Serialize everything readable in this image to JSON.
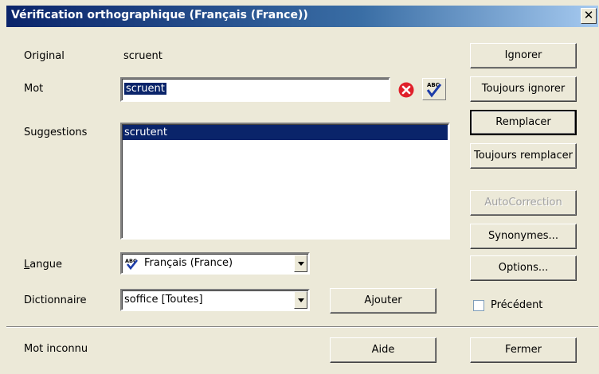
{
  "window": {
    "title": "Vérification orthographique (Français (France))",
    "close_label": "✕"
  },
  "original": {
    "label": "Original",
    "value": "scruent"
  },
  "mot": {
    "label": "Mot",
    "value": "scruent"
  },
  "suggestions": {
    "label": "Suggestions",
    "items": [
      "scrutent"
    ]
  },
  "langue": {
    "label": "Langue",
    "value": "Français (France)"
  },
  "dictionnaire": {
    "label": "Dictionnaire",
    "value": "soffice [Toutes]"
  },
  "buttons": {
    "ignorer": "Ignorer",
    "toujours_ignorer": "Toujours ignorer",
    "remplacer": "Remplacer",
    "toujours_remplacer": "Toujours remplacer",
    "autocorrection": "AutoCorrection",
    "synonymes": "Synonymes...",
    "options": "Options...",
    "ajouter": "Ajouter",
    "aide": "Aide",
    "fermer": "Fermer"
  },
  "precedent": {
    "label": "Précédent",
    "checked": false
  },
  "status": "Mot inconnu",
  "colors": {
    "selection": "#0a246a",
    "title_gradient_start": "#0a246a",
    "delete_icon": "#e0202a"
  }
}
